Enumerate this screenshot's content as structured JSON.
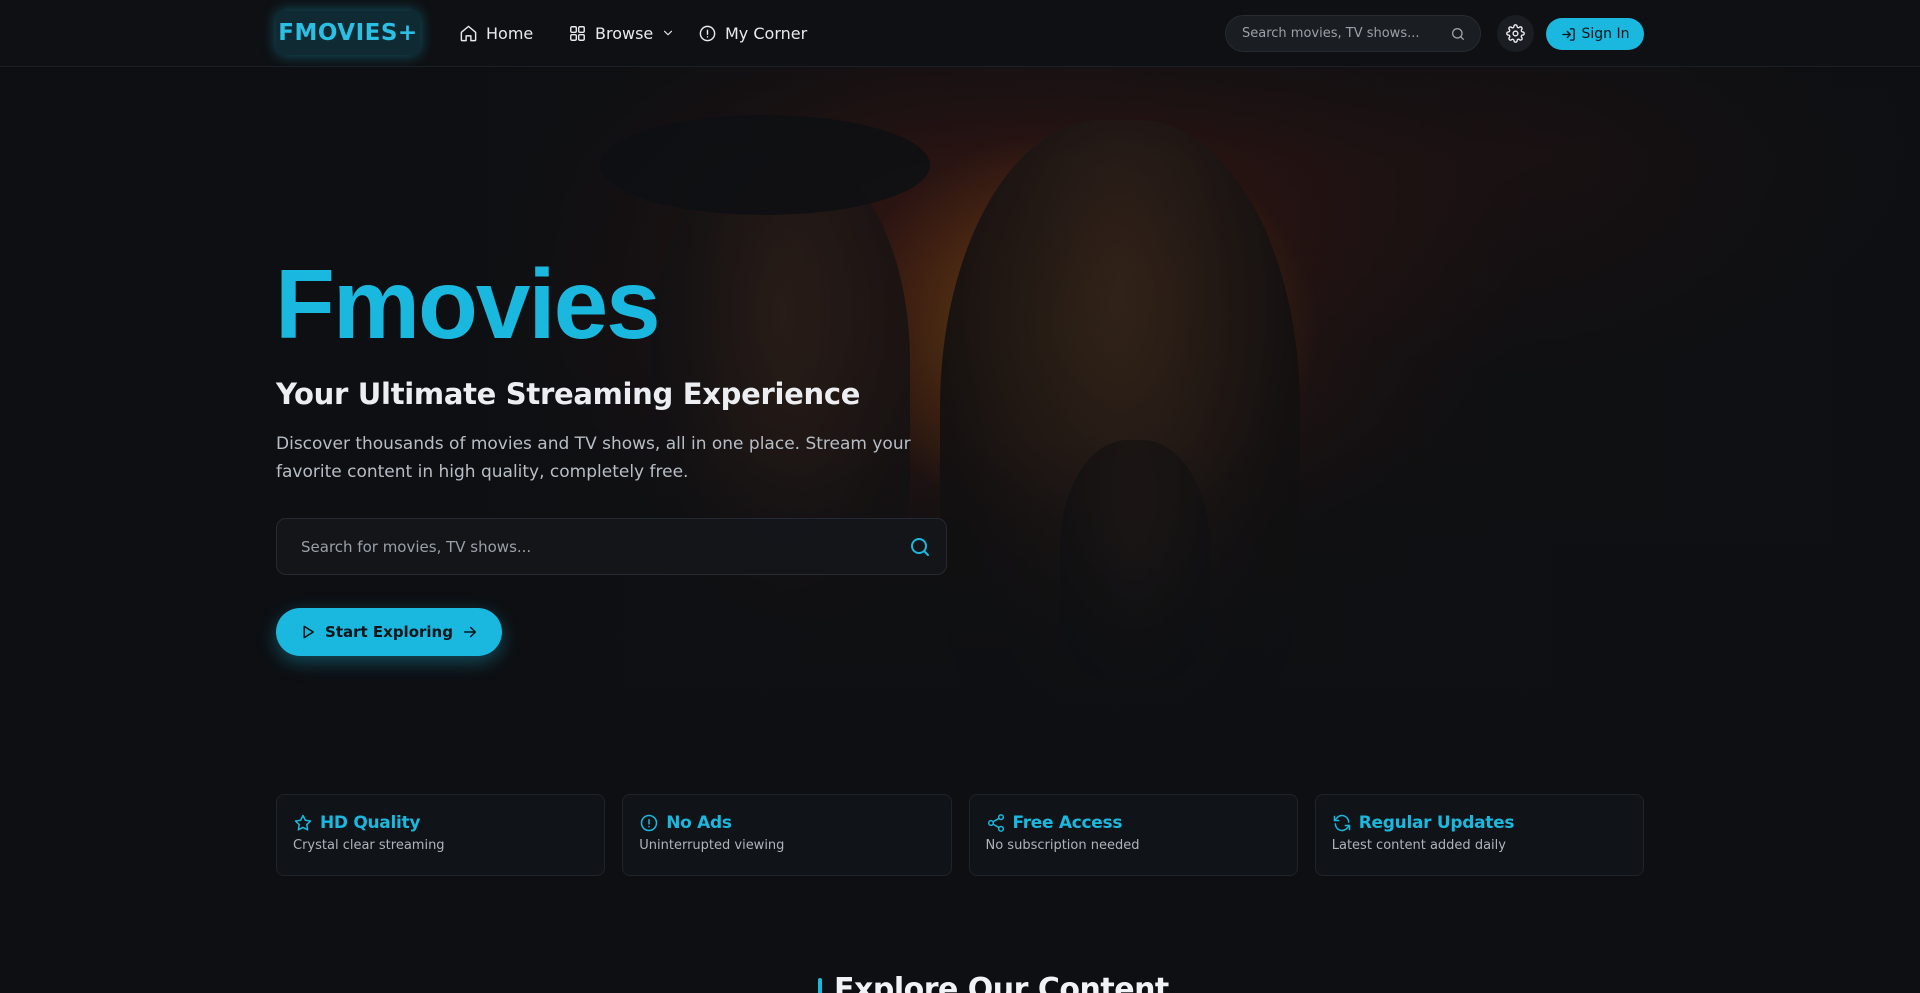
{
  "colors": {
    "accent": "#1ab8de",
    "background": "#0d0f13"
  },
  "nav": {
    "logo": "FMOVIES+",
    "links": [
      {
        "label": "Home",
        "icon": "home-icon"
      },
      {
        "label": "Browse",
        "icon": "grid-icon"
      },
      {
        "label": "My Corner",
        "icon": "info-icon"
      }
    ],
    "search_placeholder": "Search movies, TV shows...",
    "signin_label": "Sign In"
  },
  "hero": {
    "title": "Fmovies",
    "subtitle": "Your Ultimate Streaming Experience",
    "description": "Discover thousands of movies and TV shows, all in one place. Stream your favorite content in high quality, completely free.",
    "search_placeholder": "Search for movies, TV shows...",
    "cta_label": "Start Exploring"
  },
  "features": [
    {
      "title": "HD Quality",
      "subtitle": "Crystal clear streaming",
      "icon": "star-icon"
    },
    {
      "title": "No Ads",
      "subtitle": "Uninterrupted viewing",
      "icon": "info-circle-icon"
    },
    {
      "title": "Free Access",
      "subtitle": "No subscription needed",
      "icon": "share-icon"
    },
    {
      "title": "Regular Updates",
      "subtitle": "Latest content added daily",
      "icon": "refresh-icon"
    }
  ],
  "section": {
    "title": "Explore Our Content"
  }
}
